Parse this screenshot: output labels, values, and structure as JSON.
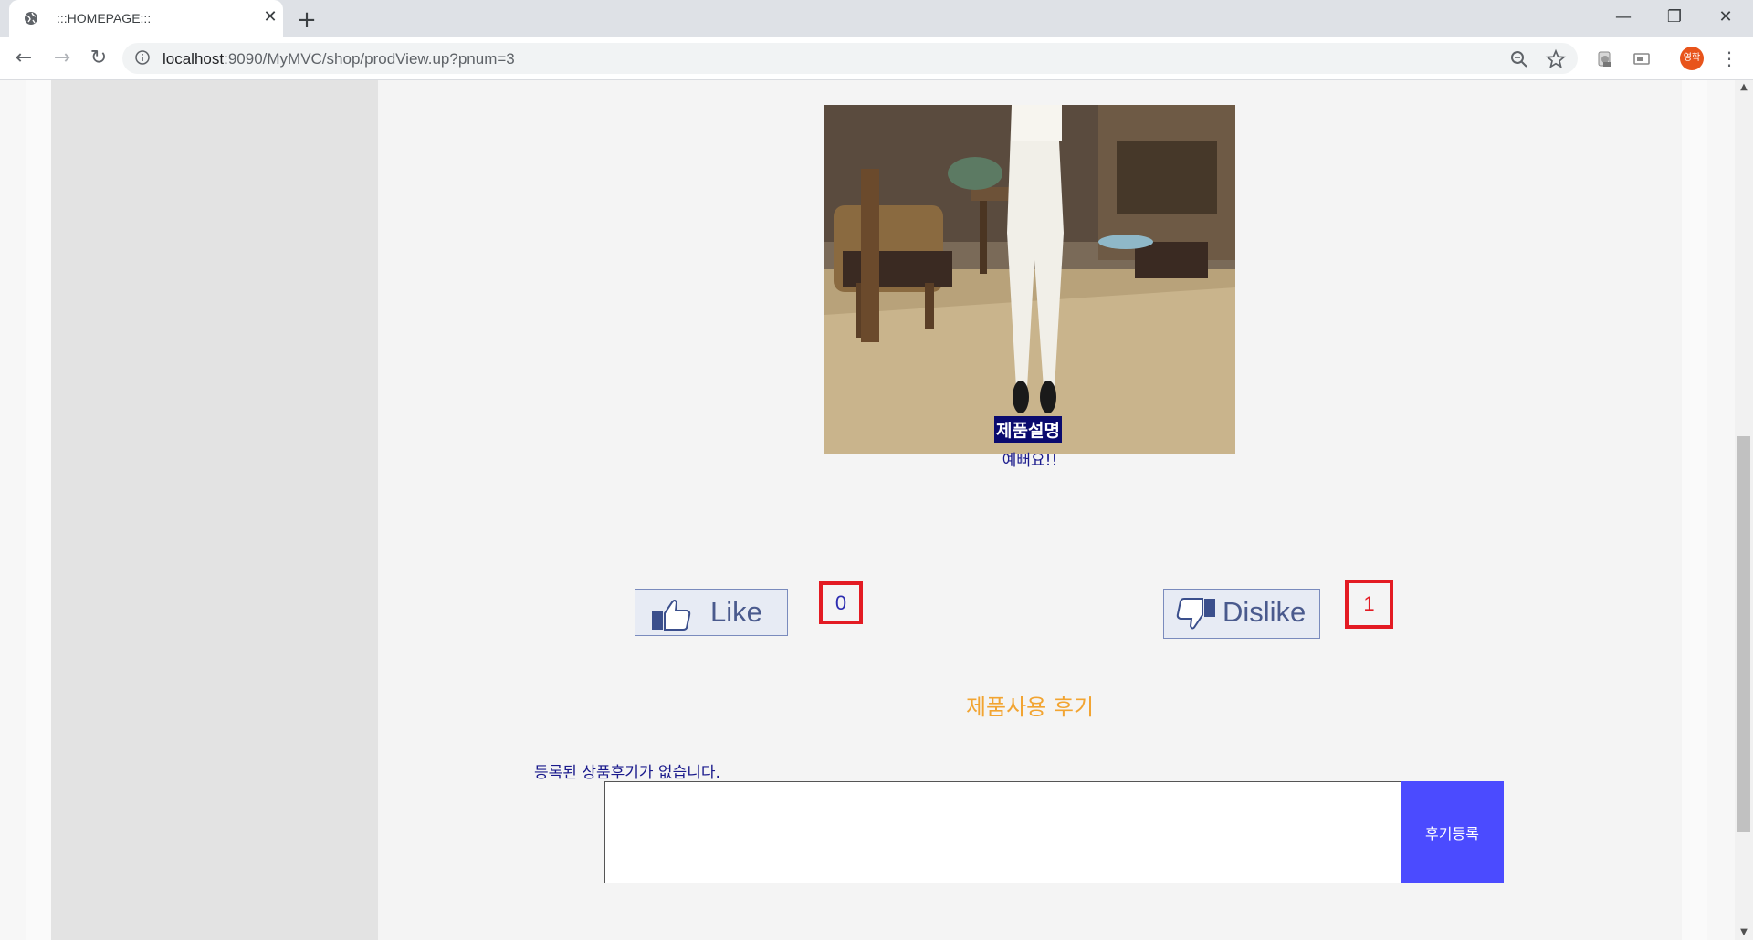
{
  "browser": {
    "tab_title": ":::HOMEPAGE:::",
    "url_host": "localhost",
    "url_path": ":9090/MyMVC/shop/prodView.up?pnum=3",
    "profile_initials": "영학"
  },
  "product": {
    "image_icon": "product-photo-white-pants",
    "desc_title": "제품설명",
    "desc_text": "예뻐요!!"
  },
  "votes": {
    "like_label": "Like",
    "like_count": "0",
    "dislike_label": "Dislike",
    "dislike_count": "1"
  },
  "reviews": {
    "title": "제품사용 후기",
    "empty_message": "등록된 상품후기가 없습니다.",
    "input_value": "",
    "submit_label": "후기등록"
  },
  "colors": {
    "accent_orange": "#f2a431",
    "submit_blue": "#4b4bff",
    "count_border_red": "#e31b23",
    "text_navy": "#1a1a8c"
  }
}
